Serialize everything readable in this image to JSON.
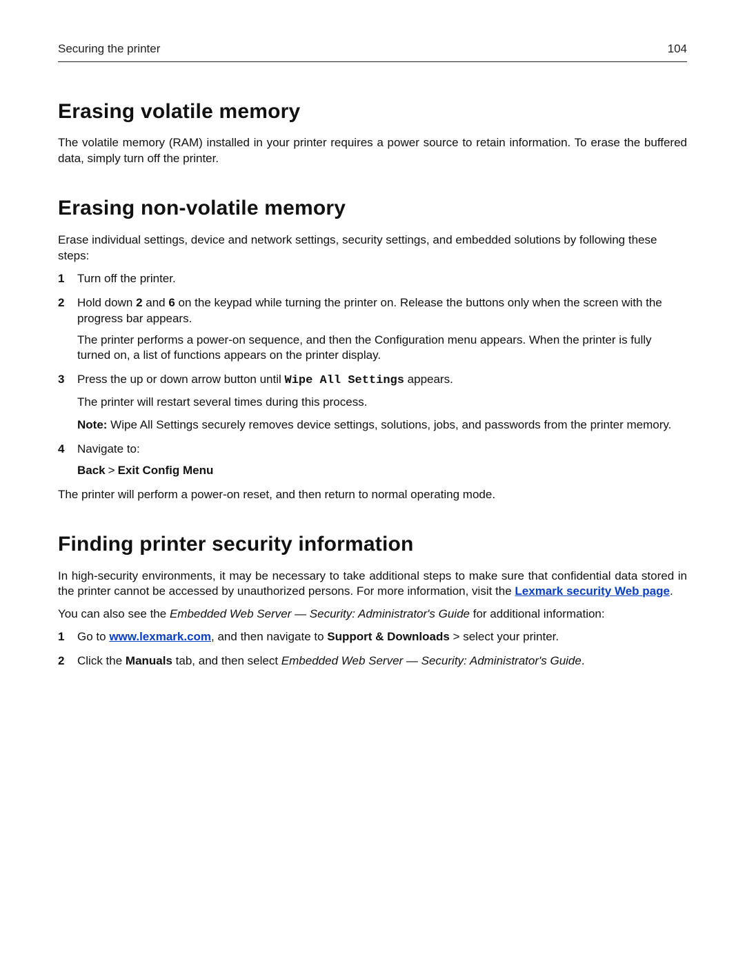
{
  "header": {
    "running_title": "Securing the printer",
    "page_number": "104"
  },
  "sec1": {
    "title": "Erasing volatile memory",
    "p1": "The volatile memory (RAM) installed in your printer requires a power source to retain information. To erase the buffered data, simply turn off the printer."
  },
  "sec2": {
    "title": "Erasing non‑volatile memory",
    "intro": "Erase individual settings, device and network settings, security settings, and embedded solutions by following these steps:",
    "steps": {
      "n1": "1",
      "s1": "Turn off the printer.",
      "n2": "2",
      "s2_a": "Hold down ",
      "s2_key1": "2",
      "s2_and": " and ",
      "s2_key2": "6",
      "s2_b": " on the keypad while turning the printer on. Release the buttons only when the screen with the progress bar appears.",
      "s2_sub": "The printer performs a power‑on sequence, and then the Configuration menu appears. When the printer is fully turned on, a list of functions appears on the printer display.",
      "n3": "3",
      "s3_a": "Press the up or down arrow button until ",
      "s3_mono": "Wipe All Settings",
      "s3_b": " appears.",
      "s3_sub": "The printer will restart several times during this process.",
      "s3_note_label": "Note:",
      "s3_note_body": " Wipe All Settings securely removes device settings, solutions, jobs, and passwords from the printer memory.",
      "n4": "4",
      "s4": "Navigate to:",
      "s4_path_back": "Back",
      "s4_path_sep": ">",
      "s4_path_exit": "Exit Config Menu"
    },
    "after": "The printer will perform a power‑on reset, and then return to normal operating mode."
  },
  "sec3": {
    "title": "Finding printer security information",
    "p1_a": "In high‑security environments, it may be necessary to take additional steps to make sure that confidential data stored in the printer cannot be accessed by unauthorized persons. For more information, visit the ",
    "p1_link": "Lexmark security Web page",
    "p1_b": ".",
    "p2_a": "You can also see the ",
    "p2_ital": "Embedded Web Server — Security: Administrator's Guide",
    "p2_b": " for additional information:",
    "steps": {
      "n1": "1",
      "s1_a": "Go to ",
      "s1_link": "www.lexmark.com",
      "s1_b": ", and then navigate to ",
      "s1_bold": "Support & Downloads",
      "s1_c": " > select your printer.",
      "n2": "2",
      "s2_a": "Click the ",
      "s2_bold": "Manuals",
      "s2_b": " tab, and then select ",
      "s2_ital": "Embedded Web Server — Security: Administrator's Guide",
      "s2_c": "."
    }
  }
}
